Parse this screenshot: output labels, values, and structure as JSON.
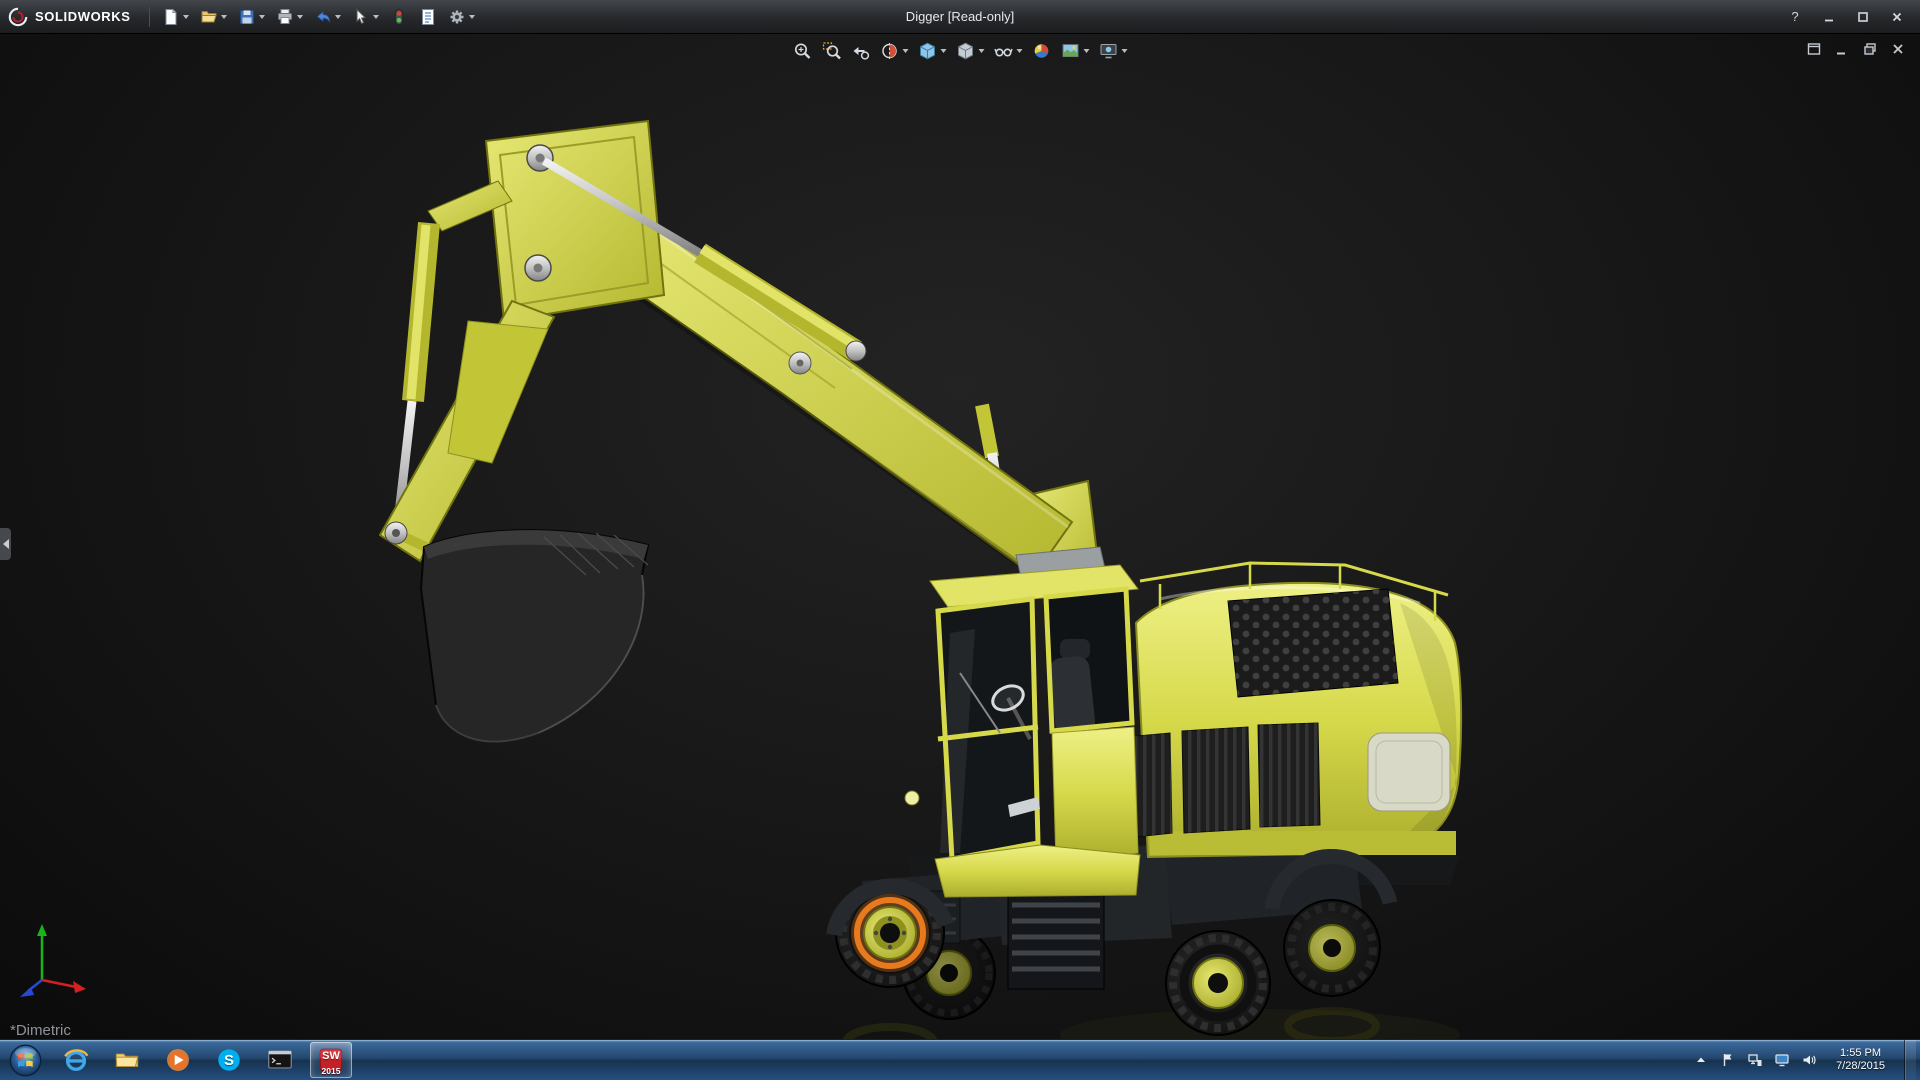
{
  "colors": {
    "machine_yellow": "#d6d94a",
    "highlight_orange": "#e87a1e",
    "viewport_background": "#161616",
    "taskbar_blue": "#24486e"
  },
  "title_bar": {
    "brand": "SOLIDWORKS",
    "title": "Digger [Read-only]",
    "help_label": "?",
    "tools": [
      {
        "name": "new",
        "dropdown": true
      },
      {
        "name": "open",
        "dropdown": true
      },
      {
        "name": "save",
        "dropdown": true
      },
      {
        "name": "print",
        "dropdown": true
      },
      {
        "name": "undo",
        "dropdown": true
      },
      {
        "name": "select",
        "dropdown": true
      },
      {
        "name": "rebuild",
        "dropdown": false
      },
      {
        "name": "file-properties",
        "dropdown": false
      },
      {
        "name": "options",
        "dropdown": true
      }
    ]
  },
  "viewport": {
    "heads_up_tools": [
      {
        "name": "zoom-to-fit"
      },
      {
        "name": "zoom-to-area"
      },
      {
        "name": "previous-view"
      },
      {
        "name": "section-view",
        "dropdown": true
      },
      {
        "name": "view-orientation",
        "dropdown": true
      },
      {
        "name": "display-style",
        "dropdown": true
      },
      {
        "name": "hide-show-items",
        "dropdown": true
      },
      {
        "name": "edit-appearance"
      },
      {
        "name": "apply-scene",
        "dropdown": true
      },
      {
        "name": "view-settings",
        "dropdown": true
      }
    ],
    "doc_window_controls": [
      {
        "name": "window-menu"
      },
      {
        "name": "minimize-doc"
      },
      {
        "name": "restore-doc"
      },
      {
        "name": "close-doc"
      }
    ],
    "orientation_label": "*Dimetric"
  },
  "taskbar": {
    "items": [
      {
        "name": "start"
      },
      {
        "name": "internet-explorer"
      },
      {
        "name": "file-explorer"
      },
      {
        "name": "media-player"
      },
      {
        "name": "skype",
        "letter": "S"
      },
      {
        "name": "command-prompt"
      },
      {
        "name": "solidworks",
        "letter": "SW",
        "badge": "2015",
        "active": true
      }
    ],
    "tray": {
      "icons": [
        {
          "name": "hidden-icons"
        },
        {
          "name": "flag"
        },
        {
          "name": "network"
        },
        {
          "name": "display"
        },
        {
          "name": "volume"
        }
      ],
      "time": "1:55 PM",
      "date": "7/28/2015"
    }
  }
}
